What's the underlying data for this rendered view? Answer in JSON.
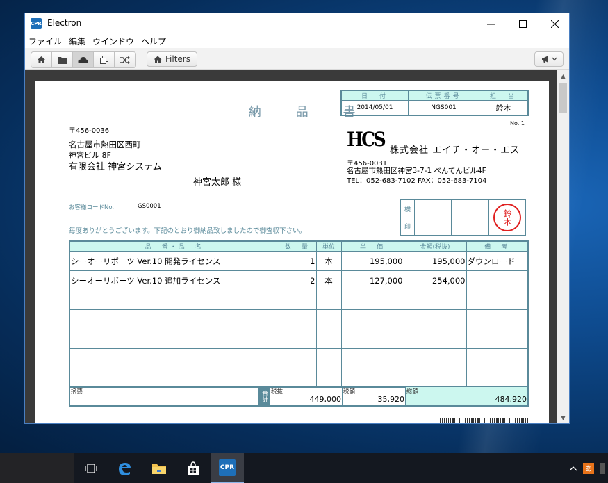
{
  "window": {
    "title": "Electron",
    "app_icon_label": "CPR",
    "controls": {
      "minimize": "—",
      "maximize": "☐",
      "close": "✕"
    }
  },
  "menu": [
    "ファイル",
    "編集",
    "ウインドウ",
    "ヘルプ"
  ],
  "toolbar": {
    "buttons": [
      "home-icon",
      "folder-icon",
      "cloud-icon",
      "copy-icon",
      "shuffle-icon"
    ],
    "filters_label": "Filters",
    "right_button": "megaphone-icon"
  },
  "document": {
    "title": "納 品 書",
    "header_labels": [
      "日　付",
      "伝票番号",
      "担　当"
    ],
    "header_values": [
      "2014/05/01",
      "NGS001",
      "鈴木"
    ],
    "doc_no": "No. 1",
    "customer": {
      "postal": "〒456-0036",
      "address1": "名古屋市熱田区西町",
      "address2": "神宮ビル 8F",
      "company": "有限会社 神宮システム",
      "person": "神宮太郎 様"
    },
    "customer_code_label": "お客様コードNo.",
    "customer_code": "GS0001",
    "greeting": "毎度ありがとうございます。下記のとおり御納品致しましたので御査収下さい。",
    "seller": {
      "logo": "HCS",
      "company": "株式会社 エイチ・オー・エス",
      "postal": "〒456-0031",
      "address": "名古屋市熱田区神宮3-7-1 べんてんビル4F",
      "tel_fax": "TEL：052-683-7102 FAX：052-683-7104"
    },
    "stamp": {
      "label_top": "検",
      "label_bottom": "印",
      "seal_text": "鈴木"
    },
    "columns": [
      "品　番・品　名",
      "数　量",
      "単位",
      "単　価",
      "金額(税抜)",
      "備　考"
    ],
    "rows": [
      {
        "name": "シーオーリポーツ Ver.10 開発ライセンス",
        "qty": "1",
        "unit": "本",
        "price": "195,000",
        "amount": "195,000",
        "note": "ダウンロード"
      },
      {
        "name": "シーオーリポーツ Ver.10 追加ライセンス",
        "qty": "2",
        "unit": "本",
        "price": "127,000",
        "amount": "254,000",
        "note": ""
      },
      {
        "name": "",
        "qty": "",
        "unit": "",
        "price": "",
        "amount": "",
        "note": ""
      },
      {
        "name": "",
        "qty": "",
        "unit": "",
        "price": "",
        "amount": "",
        "note": ""
      },
      {
        "name": "",
        "qty": "",
        "unit": "",
        "price": "",
        "amount": "",
        "note": ""
      },
      {
        "name": "",
        "qty": "",
        "unit": "",
        "price": "",
        "amount": "",
        "note": ""
      },
      {
        "name": "",
        "qty": "",
        "unit": "",
        "price": "",
        "amount": "",
        "note": ""
      }
    ],
    "totals": {
      "memo_label": "摘要",
      "total_label": "合計",
      "subtotal_label": "税抜",
      "subtotal": "449,000",
      "tax_label": "税額",
      "tax": "35,920",
      "grand_label": "総額",
      "grand": "484,920"
    }
  },
  "taskbar": {
    "items": [
      "task-view-icon",
      "edge-icon",
      "explorer-icon",
      "store-icon",
      "cpr-app-icon"
    ],
    "active": "cpr-app-icon"
  },
  "colors": {
    "accent": "#5a8a9a",
    "header_fill": "#ccf7ef",
    "seal": "#e02020",
    "desktop": "#0e4b8f"
  }
}
